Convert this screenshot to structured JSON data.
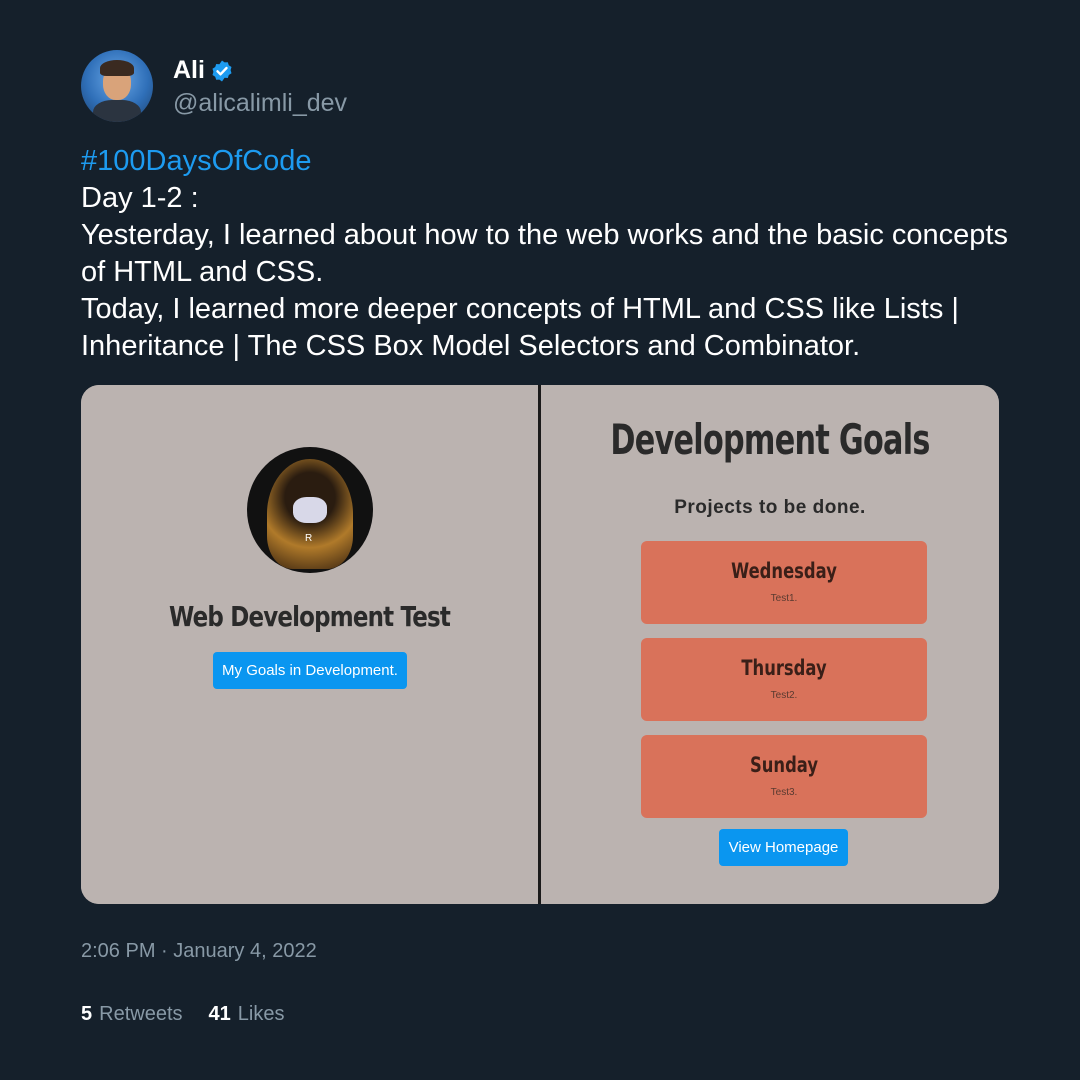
{
  "user": {
    "display_name": "Ali",
    "handle": "@alicalimli_dev",
    "verified_icon": "verified-badge-icon",
    "accent_color": "#1d9bf0"
  },
  "tweet": {
    "hashtag": "#100DaysOfCode",
    "lines": [
      "Day 1-2 :",
      "Yesterday, I learned about how to the web works and the basic concepts of HTML and CSS.",
      "Today, I learned more deeper concepts of HTML and CSS like Lists | Inheritance | The CSS Box Model Selectors and Combinator."
    ]
  },
  "media": {
    "left": {
      "title": "Web Development Test",
      "button": "My Goals in Development."
    },
    "right": {
      "title": "Development Goals",
      "subtitle": "Projects to be done.",
      "cards": [
        {
          "day": "Wednesday",
          "text": "Test1."
        },
        {
          "day": "Thursday",
          "text": "Test2."
        },
        {
          "day": "Sunday",
          "text": "Test3."
        }
      ],
      "button": "View Homepage"
    }
  },
  "meta": {
    "timestamp": "2:06 PM · January 4, 2022"
  },
  "stats": {
    "retweets_count": "5",
    "retweets_label": "Retweets",
    "likes_count": "41",
    "likes_label": "Likes"
  }
}
